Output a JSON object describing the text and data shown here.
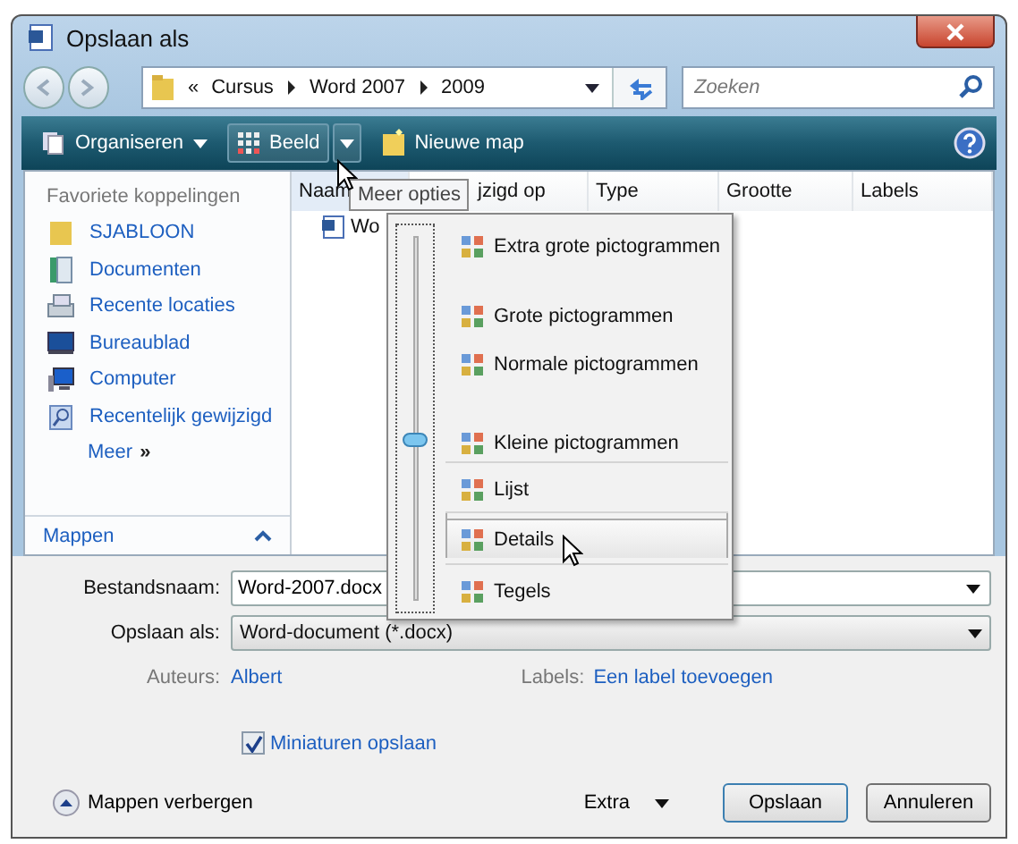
{
  "window": {
    "title": "Opslaan als"
  },
  "address": {
    "chevron": "«",
    "crumbs": [
      "Cursus",
      "Word 2007",
      "2009"
    ]
  },
  "search": {
    "placeholder": "Zoeken"
  },
  "toolbar": {
    "organize": "Organiseren",
    "view": "Beeld",
    "new_folder": "Nieuwe map"
  },
  "tooltip": "Meer opties",
  "sidebar": {
    "heading": "Favoriete koppelingen",
    "items": [
      {
        "label": "SJABLOON",
        "kind": "folder"
      },
      {
        "label": "Documenten",
        "kind": "documents"
      },
      {
        "label": "Recente locaties",
        "kind": "recent"
      },
      {
        "label": "Bureaublad",
        "kind": "desktop"
      },
      {
        "label": "Computer",
        "kind": "computer"
      },
      {
        "label": "Recentelijk gewijzigd",
        "kind": "search"
      }
    ],
    "more": "Meer",
    "more_mark": "»",
    "folders": "Mappen"
  },
  "table": {
    "columns": [
      "Naam",
      "jzigd op",
      "Type",
      "Grootte",
      "Labels"
    ],
    "rows": [
      {
        "name": "Wo"
      }
    ]
  },
  "view_menu": {
    "level": 0.45,
    "items": [
      {
        "label": "Extra grote pictogrammen",
        "selected": false,
        "separator": false
      },
      {
        "label": "Grote pictogrammen",
        "selected": false,
        "separator": false
      },
      {
        "label": "Normale pictogrammen",
        "selected": false,
        "separator": false
      },
      {
        "label": "Kleine pictogrammen",
        "selected": false,
        "separator": false
      },
      {
        "label": "Lijst",
        "selected": false,
        "separator": true
      },
      {
        "label": "Details",
        "selected": true,
        "separator": true
      },
      {
        "label": "Tegels",
        "selected": false,
        "separator": true
      }
    ]
  },
  "form": {
    "filename_label": "Bestandsnaam:",
    "filename": "Word-2007.docx",
    "type_label": "Opslaan als:",
    "type": "Word-document (*.docx)",
    "authors_label": "Auteurs:",
    "authors": "Albert",
    "labels_label": "Labels:",
    "labels": "Een label toevoegen",
    "thumbnails": {
      "label": "Miniaturen opslaan",
      "checked": true
    }
  },
  "footer": {
    "hide_folders": "Mappen verbergen",
    "tools": "Extra",
    "buttons": [
      "Opslaan",
      "Annuleren"
    ]
  }
}
